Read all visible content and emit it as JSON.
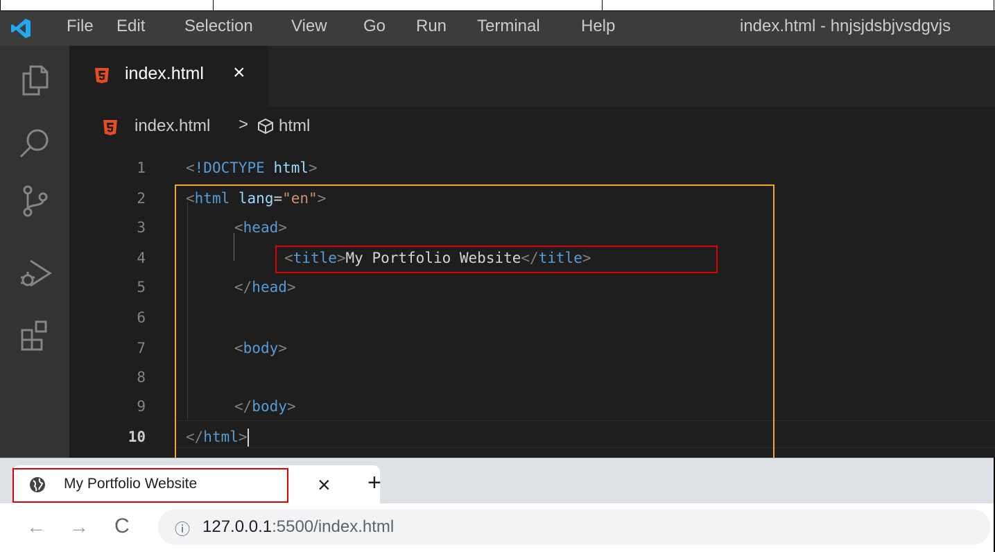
{
  "window": {
    "menu": [
      "File",
      "Edit",
      "Selection",
      "View",
      "Go",
      "Run",
      "Terminal",
      "Help"
    ],
    "title": "index.html - hnjsjdsbjvsdgvjs"
  },
  "activity_bar": [
    "explorer-icon",
    "search-icon",
    "source-control-icon",
    "run-debug-icon",
    "extensions-icon"
  ],
  "editor_tab": {
    "icon": "html5-icon",
    "label": "index.html",
    "close_glyph": "×"
  },
  "breadcrumb": {
    "file": "index.html",
    "separator": ">",
    "symbol": "html"
  },
  "code_lines": [
    {
      "n": "1",
      "text": "<!DOCTYPE html>"
    },
    {
      "n": "2",
      "text": "<html lang=\"en\">"
    },
    {
      "n": "3",
      "text": "    <head>"
    },
    {
      "n": "4",
      "text": "        <title>My Portfolio Website</title>"
    },
    {
      "n": "5",
      "text": "    </head>"
    },
    {
      "n": "6",
      "text": ""
    },
    {
      "n": "7",
      "text": "    <body>"
    },
    {
      "n": "8",
      "text": ""
    },
    {
      "n": "9",
      "text": "    </body>"
    },
    {
      "n": "10",
      "text": "</html>"
    }
  ],
  "code_tokens": {
    "doctype_open": "<!DOCTYPE ",
    "doctype_kw": "html",
    "doctype_close": ">",
    "html_lt": "<",
    "html_tag": "html",
    "lang_attr": "lang",
    "eq": "=",
    "lang_val": "\"en\"",
    "gt": ">",
    "head_tag": "head",
    "title_tag": "title",
    "title_text": "My Portfolio Website",
    "close_lt": "</",
    "body_tag": "body"
  },
  "annotations": {
    "outer_box_color": "#f5a623",
    "title_box_color": "#e00000"
  },
  "browser": {
    "tab_title": "My Portfolio Website",
    "tab_close": "×",
    "new_tab": "+",
    "url_host": "127.0.0.1",
    "url_rest": ":5500/index.html",
    "back": "←",
    "forward": "→",
    "reload": "C",
    "info": "ⓘ"
  },
  "colors": {
    "editor_bg": "#1e1e1e",
    "tag": "#569cd6",
    "attr": "#9cdcfe",
    "string": "#ce9178",
    "html5_orange": "#e44d26"
  }
}
